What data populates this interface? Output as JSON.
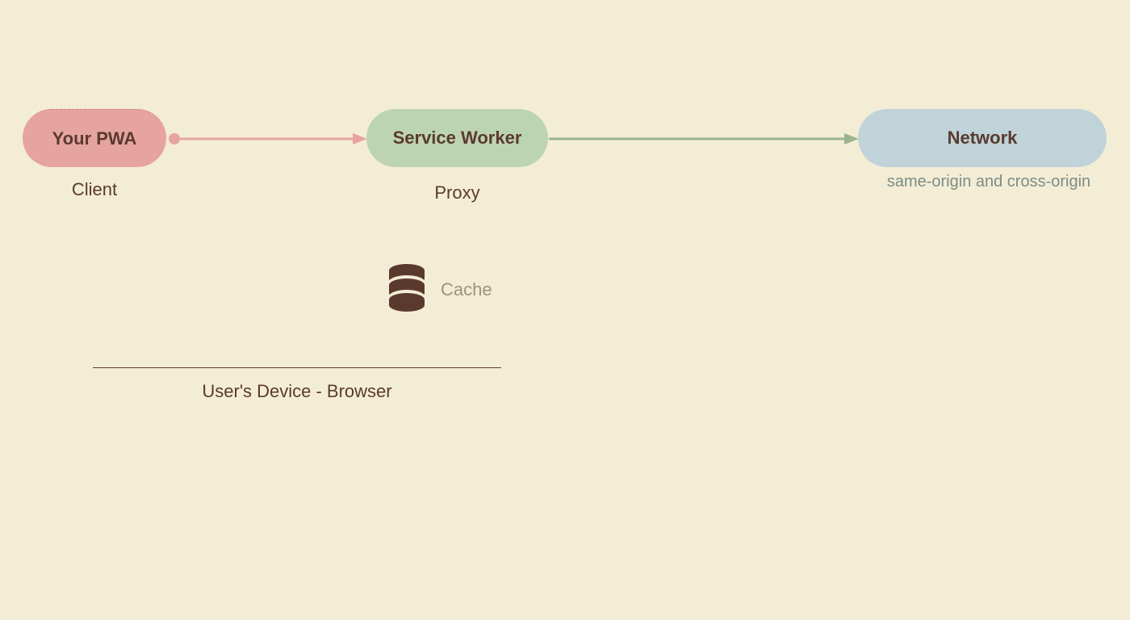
{
  "nodes": {
    "pwa": {
      "label": "Your PWA",
      "sublabel": "Client"
    },
    "service_worker": {
      "label": "Service Worker",
      "sublabel": "Proxy"
    },
    "network": {
      "label": "Network",
      "sublabel": "same-origin and cross-origin"
    },
    "cache": {
      "label": "Cache"
    }
  },
  "edges": {
    "pwa_to_sw": {
      "from": "pwa",
      "to": "service_worker",
      "color": "#e6a4a1"
    },
    "sw_to_net": {
      "from": "service_worker",
      "to": "network",
      "color": "#9bb48e"
    }
  },
  "footer": {
    "device_label": "User's Device - Browser"
  },
  "colors": {
    "bg": "#f4edd5",
    "pink": "#e6a4a1",
    "green": "#bdd4b2",
    "green_arrow": "#9bb48e",
    "blue": "#bfd3d9",
    "text_dark": "#5a3a2e",
    "muted": "#9b9380",
    "net_sub": "#7b8d87"
  }
}
